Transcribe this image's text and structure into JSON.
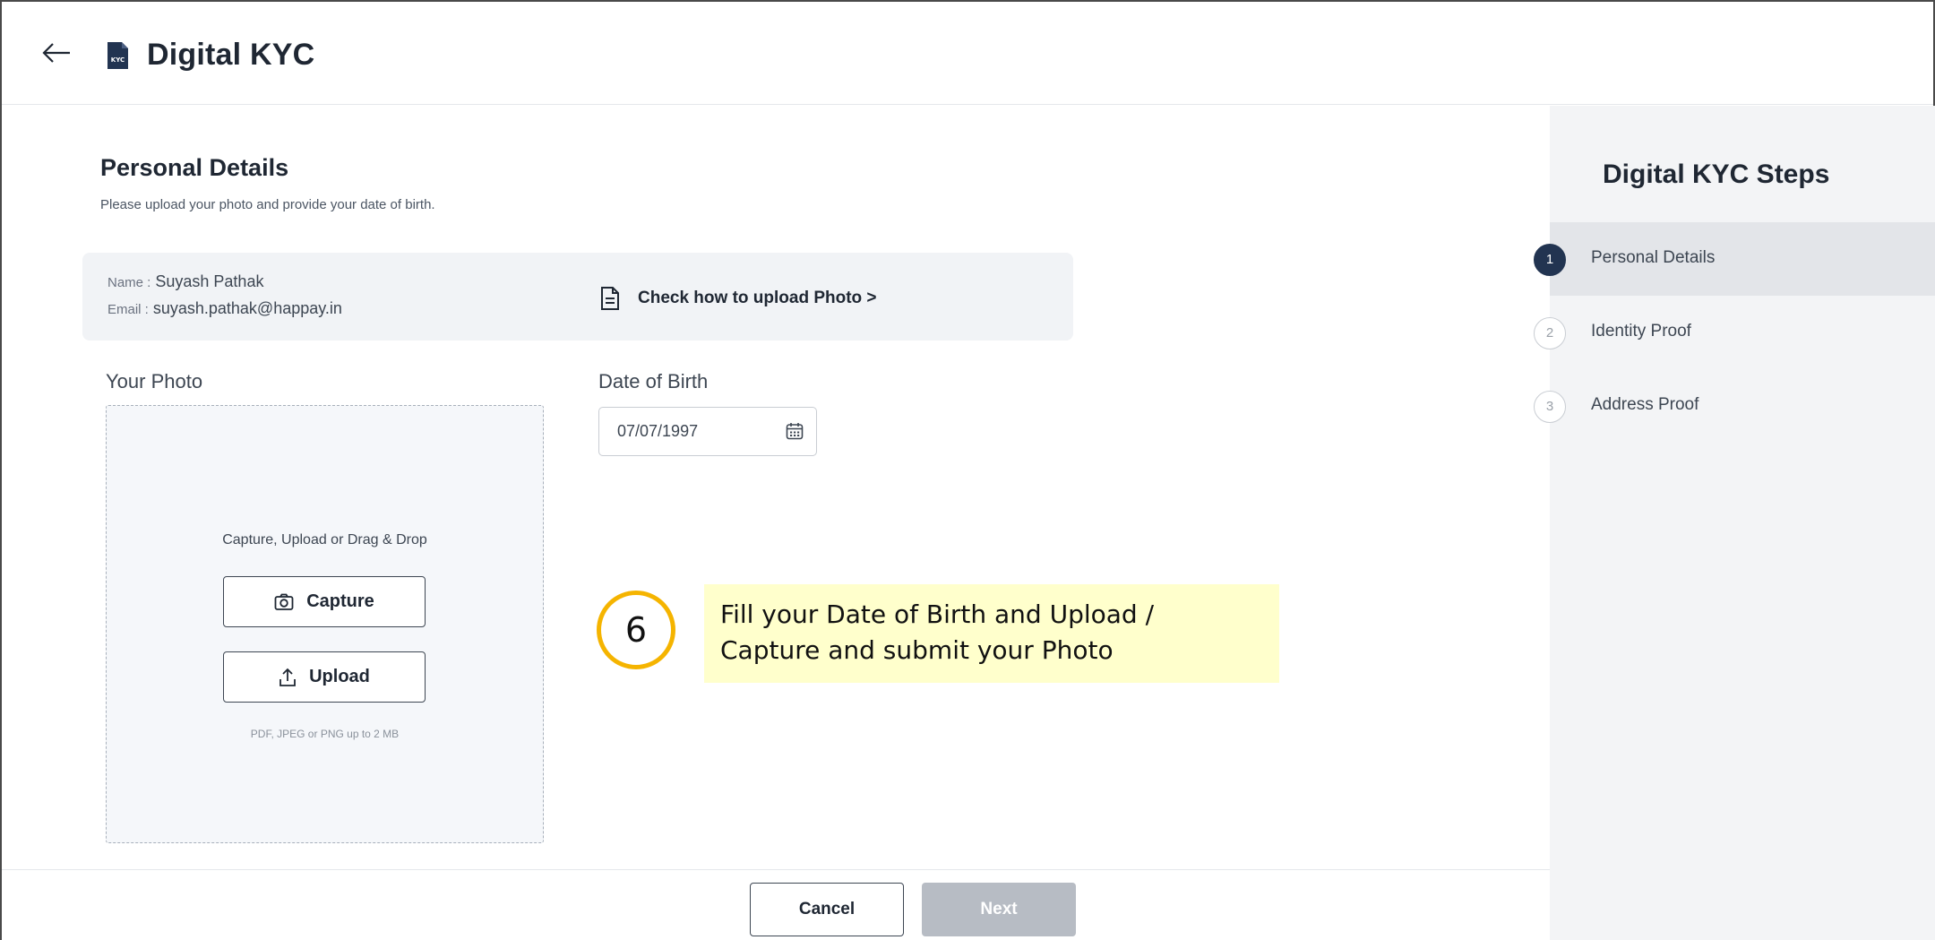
{
  "header": {
    "title": "Digital KYC",
    "icon_badge": "KYC"
  },
  "personal": {
    "title": "Personal Details",
    "subtitle": "Please upload your photo and provide your date of birth."
  },
  "info": {
    "name_label": "Name :",
    "name_value": "Suyash Pathak",
    "email_label": "Email :",
    "email_value": "suyash.pathak@happay.in",
    "check_link": "Check how to upload Photo >"
  },
  "photo": {
    "label": "Your Photo",
    "drop_text": "Capture, Upload or Drag & Drop",
    "capture_label": "Capture",
    "upload_label": "Upload",
    "hint": "PDF, JPEG or PNG up to 2 MB"
  },
  "dob": {
    "label": "Date of Birth",
    "value": "07/07/1997"
  },
  "annotation": {
    "number": "6",
    "line1": "Fill your Date of Birth and Upload /",
    "line2": "Capture and submit your Photo"
  },
  "sidebar": {
    "title": "Digital KYC Steps",
    "steps": [
      {
        "num": "1",
        "label": "Personal Details",
        "state": "active"
      },
      {
        "num": "2",
        "label": "Identity Proof",
        "state": "pending"
      },
      {
        "num": "3",
        "label": "Address Proof",
        "state": "pending"
      }
    ]
  },
  "footer": {
    "cancel_label": "Cancel",
    "next_label": "Next"
  },
  "colors": {
    "primary_dark": "#223451",
    "sidebar_bg": "#f3f4f6",
    "callout_bg": "#ffffcc",
    "badge_ring": "#f5b400",
    "disabled_button": "#b7bcc4"
  },
  "icons": [
    "back-arrow-icon",
    "kyc-document-icon",
    "document-icon",
    "camera-icon",
    "upload-icon",
    "calendar-icon"
  ]
}
